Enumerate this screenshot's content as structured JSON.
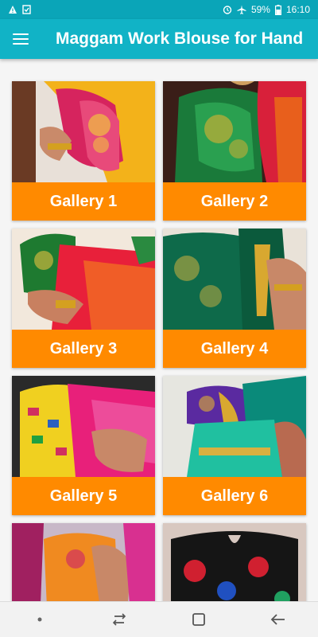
{
  "status_bar": {
    "battery_percent": "59%",
    "time": "16:10",
    "icons": [
      "warning-icon",
      "clipboard-check-icon",
      "alarm-icon",
      "airplane-icon",
      "battery-icon"
    ]
  },
  "app_bar": {
    "title": "Maggam Work Blouse for Hand",
    "menu_icon": "hamburger-menu-icon"
  },
  "gallery": {
    "items": [
      {
        "label": "Gallery 1"
      },
      {
        "label": "Gallery 2"
      },
      {
        "label": "Gallery 3"
      },
      {
        "label": "Gallery 4"
      },
      {
        "label": "Gallery 5"
      },
      {
        "label": "Gallery 6"
      },
      {
        "label": ""
      },
      {
        "label": ""
      }
    ]
  },
  "colors": {
    "app_bar": "#11b3c6",
    "status_bar": "#0aa5b8",
    "label_bg": "#ff8a00"
  },
  "nav_bar": {
    "icons": [
      "dot-icon",
      "recent-apps-icon",
      "home-icon",
      "back-icon"
    ]
  }
}
